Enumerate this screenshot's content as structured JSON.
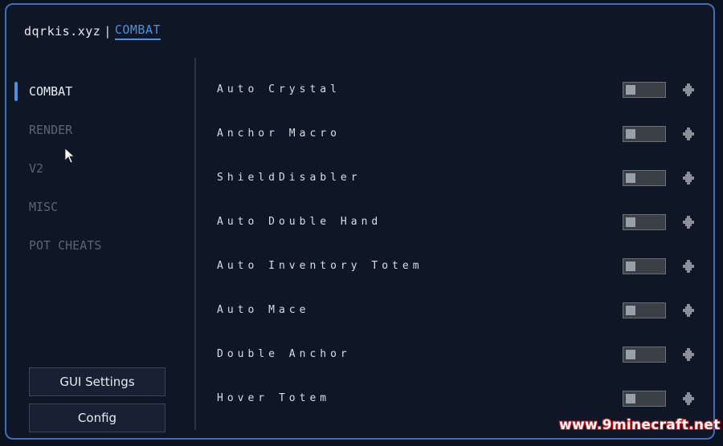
{
  "header": {
    "app_name": "dqrkis.xyz",
    "separator": "|",
    "active_category": "COMBAT"
  },
  "sidebar": {
    "items": [
      {
        "label": "COMBAT",
        "active": true
      },
      {
        "label": "RENDER",
        "active": false
      },
      {
        "label": "V2",
        "active": false
      },
      {
        "label": "MISC",
        "active": false
      },
      {
        "label": "POT CHEATS",
        "active": false
      }
    ],
    "gui_settings_label": "GUI Settings",
    "config_label": "Config"
  },
  "modules": [
    {
      "name": "Auto Crystal",
      "enabled": false
    },
    {
      "name": "Anchor Macro",
      "enabled": false
    },
    {
      "name": "ShieldDisabler",
      "enabled": false
    },
    {
      "name": "Auto Double Hand",
      "enabled": false
    },
    {
      "name": "Auto Inventory Totem",
      "enabled": false
    },
    {
      "name": "Auto Mace",
      "enabled": false
    },
    {
      "name": "Double Anchor",
      "enabled": false
    },
    {
      "name": "Hover Totem",
      "enabled": false
    }
  ],
  "icons": {
    "drag": "move-handle-icon",
    "cursor": "mouse-cursor-icon"
  },
  "colors": {
    "accent": "#4d8fe0",
    "panel": "#0f1726",
    "border": "#3f6fb8"
  },
  "watermark": "www.9minecraft.net"
}
